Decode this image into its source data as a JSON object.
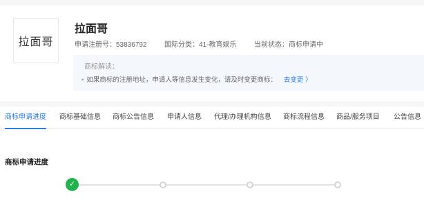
{
  "header": {
    "logo_text": "拉面哥",
    "title": "拉面哥",
    "reg_no": "申请注册号：53836792",
    "intl_class": "国际分类：41-教育娱乐",
    "status": "当前状态：商标申请中"
  },
  "notice": {
    "title": "商标解读：",
    "text": "如果商标的注册地址，申请人等信息发生变化，请及时变更商标：",
    "link": "去变更 〉"
  },
  "tabs": [
    {
      "label": "商标申请进度",
      "active": true
    },
    {
      "label": "商标基础信息"
    },
    {
      "label": "商标公告信息"
    },
    {
      "label": "申请人信息"
    },
    {
      "label": "代理/办理机构信息"
    },
    {
      "label": "商标流程信息"
    },
    {
      "label": "商品/服务项目"
    },
    {
      "label": "公告信息"
    }
  ],
  "progress": {
    "title": "商标申请进度",
    "check_glyph": "✓"
  },
  "colors": {
    "accent": "#2a7de1",
    "success": "#21b34b"
  }
}
